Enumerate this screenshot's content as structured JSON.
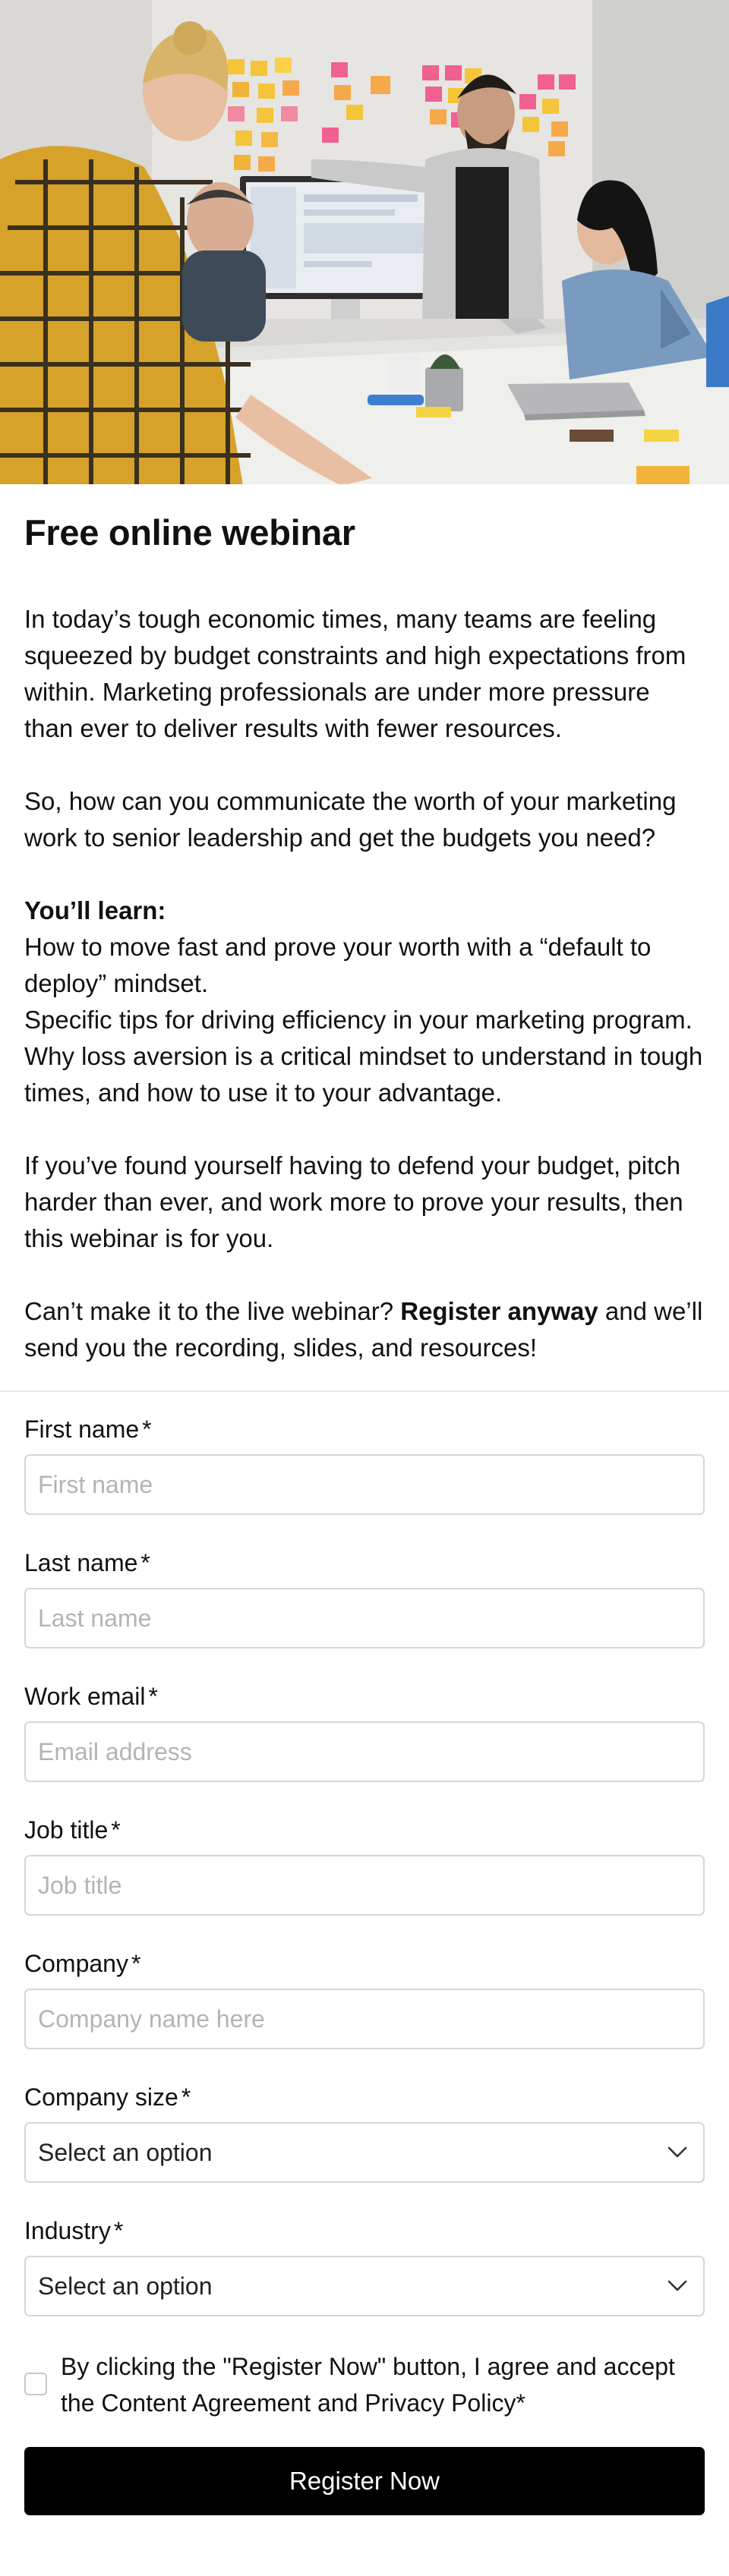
{
  "hero": {
    "image_alt": "Team meeting around a monitor with sticky notes on the wall"
  },
  "page": {
    "title": "Free online webinar"
  },
  "intro": {
    "p1": "In today’s tough economic times, many teams are feeling squeezed by budget constraints and high expectations from within. Marketing professionals are under more pressure than ever to deliver results with fewer resources.",
    "p2": "So, how can you communicate the worth of your marketing work to senior leadership and get the budgets you need?",
    "learn_heading": "You’ll learn:",
    "bullet_glyph": "",
    "bullets": [
      "How to move fast and prove your worth with a “default to deploy” mindset.",
      "Specific tips for driving efficiency in your marketing program.",
      "Why loss aversion is a critical mindset to understand in tough times, and how to use it to your advantage."
    ],
    "p3": "If you’ve found yourself having to defend your budget, pitch harder than ever, and work more to prove your results, then this webinar is for you.",
    "p4_pre": "Can’t make it to the live webinar? ",
    "p4_bold": "Register anyway",
    "p4_post": " and we’ll send you the recording, slides, and resources!"
  },
  "form": {
    "required_mark": "*",
    "first_name": {
      "label": "First name",
      "placeholder": "First name",
      "value": ""
    },
    "last_name": {
      "label": "Last name",
      "placeholder": "Last name",
      "value": ""
    },
    "work_email": {
      "label": "Work email",
      "placeholder": "Email address",
      "value": ""
    },
    "job_title": {
      "label": "Job title",
      "placeholder": "Job title",
      "value": ""
    },
    "company": {
      "label": "Company",
      "placeholder": "Company name here",
      "value": ""
    },
    "company_size": {
      "label": "Company size",
      "selected": "Select an option"
    },
    "industry": {
      "label": "Industry",
      "selected": "Select an option"
    },
    "consent_text": "By clicking the \"Register Now\" button, I agree and accept the Content Agreement and Privacy Policy",
    "submit_label": "Register Now"
  },
  "colors": {
    "button_bg": "#000000",
    "button_text": "#ffffff",
    "border": "#d6d6d6",
    "placeholder": "#b4b4b4"
  }
}
